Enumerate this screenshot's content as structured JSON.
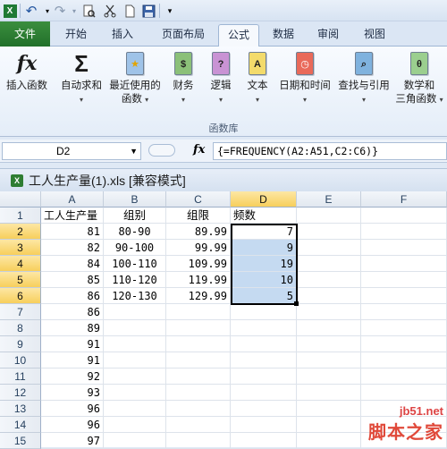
{
  "quick_access": {
    "icons": [
      "excel-app-icon",
      "undo-icon",
      "redo-icon",
      "print-preview-icon",
      "cut-icon",
      "new-icon",
      "save-icon",
      "customize-icon"
    ],
    "undo_glyph": "↶",
    "redo_glyph": "↷"
  },
  "tabs": {
    "file": "文件",
    "items": [
      "开始",
      "插入",
      "页面布局",
      "公式",
      "数据",
      "审阅",
      "视图"
    ],
    "active": "公式"
  },
  "ribbon": {
    "buttons": [
      {
        "line1": "插入函数",
        "line2": "",
        "has_drop": false
      },
      {
        "line1": "自动求和",
        "line2": "",
        "has_drop": true
      },
      {
        "line1": "最近使用的",
        "line2": "函数",
        "has_drop": true
      },
      {
        "line1": "财务",
        "line2": "",
        "has_drop": true
      },
      {
        "line1": "逻辑",
        "line2": "",
        "has_drop": true
      },
      {
        "line1": "文本",
        "line2": "",
        "has_drop": true
      },
      {
        "line1": "日期和时间",
        "line2": "",
        "has_drop": true
      },
      {
        "line1": "查找与引用",
        "line2": "",
        "has_drop": true
      },
      {
        "line1": "数学和",
        "line2": "三角函数",
        "has_drop": true
      }
    ],
    "group_label": "函数库",
    "glyphs": {
      "fx": "fx",
      "sigma": "Σ",
      "recent": "★",
      "finance": "$",
      "logic": "?",
      "text": "A",
      "date": "◷",
      "lookup": "⌕",
      "math": "θ"
    }
  },
  "formula_bar": {
    "name_box": "D2",
    "fx_label": "fx",
    "formula": "{=FREQUENCY(A2:A51,C2:C6)}"
  },
  "workbook": {
    "title": "工人生产量(1).xls  [兼容模式]",
    "icon_glyph": "X"
  },
  "sheet": {
    "columns": [
      "A",
      "B",
      "C",
      "D",
      "E",
      "F"
    ],
    "selected_column": "D",
    "rows": [
      {
        "n": "1",
        "a": "工人生产量",
        "b": "组别",
        "c": "组限",
        "d": "频数"
      },
      {
        "n": "2",
        "a": "81",
        "b": "80-90",
        "c": "89.99",
        "d": "7"
      },
      {
        "n": "3",
        "a": "82",
        "b": "90-100",
        "c": "99.99",
        "d": "9"
      },
      {
        "n": "4",
        "a": "84",
        "b": "100-110",
        "c": "109.99",
        "d": "19"
      },
      {
        "n": "5",
        "a": "85",
        "b": "110-120",
        "c": "119.99",
        "d": "10"
      },
      {
        "n": "6",
        "a": "86",
        "b": "120-130",
        "c": "129.99",
        "d": "5"
      },
      {
        "n": "7",
        "a": "86",
        "b": "",
        "c": "",
        "d": ""
      },
      {
        "n": "8",
        "a": "89",
        "b": "",
        "c": "",
        "d": ""
      },
      {
        "n": "9",
        "a": "91",
        "b": "",
        "c": "",
        "d": ""
      },
      {
        "n": "10",
        "a": "91",
        "b": "",
        "c": "",
        "d": ""
      },
      {
        "n": "11",
        "a": "92",
        "b": "",
        "c": "",
        "d": ""
      },
      {
        "n": "12",
        "a": "93",
        "b": "",
        "c": "",
        "d": ""
      },
      {
        "n": "13",
        "a": "96",
        "b": "",
        "c": "",
        "d": ""
      },
      {
        "n": "14",
        "a": "96",
        "b": "",
        "c": "",
        "d": ""
      },
      {
        "n": "15",
        "a": "97",
        "b": "",
        "c": "",
        "d": ""
      }
    ]
  },
  "watermark": {
    "url": "jb51.net",
    "name": "脚本之家"
  },
  "colors": {
    "file_tab": "#2a7a2f",
    "selection_fill": "#c5daf1",
    "selected_header": "#f7cf5c"
  }
}
